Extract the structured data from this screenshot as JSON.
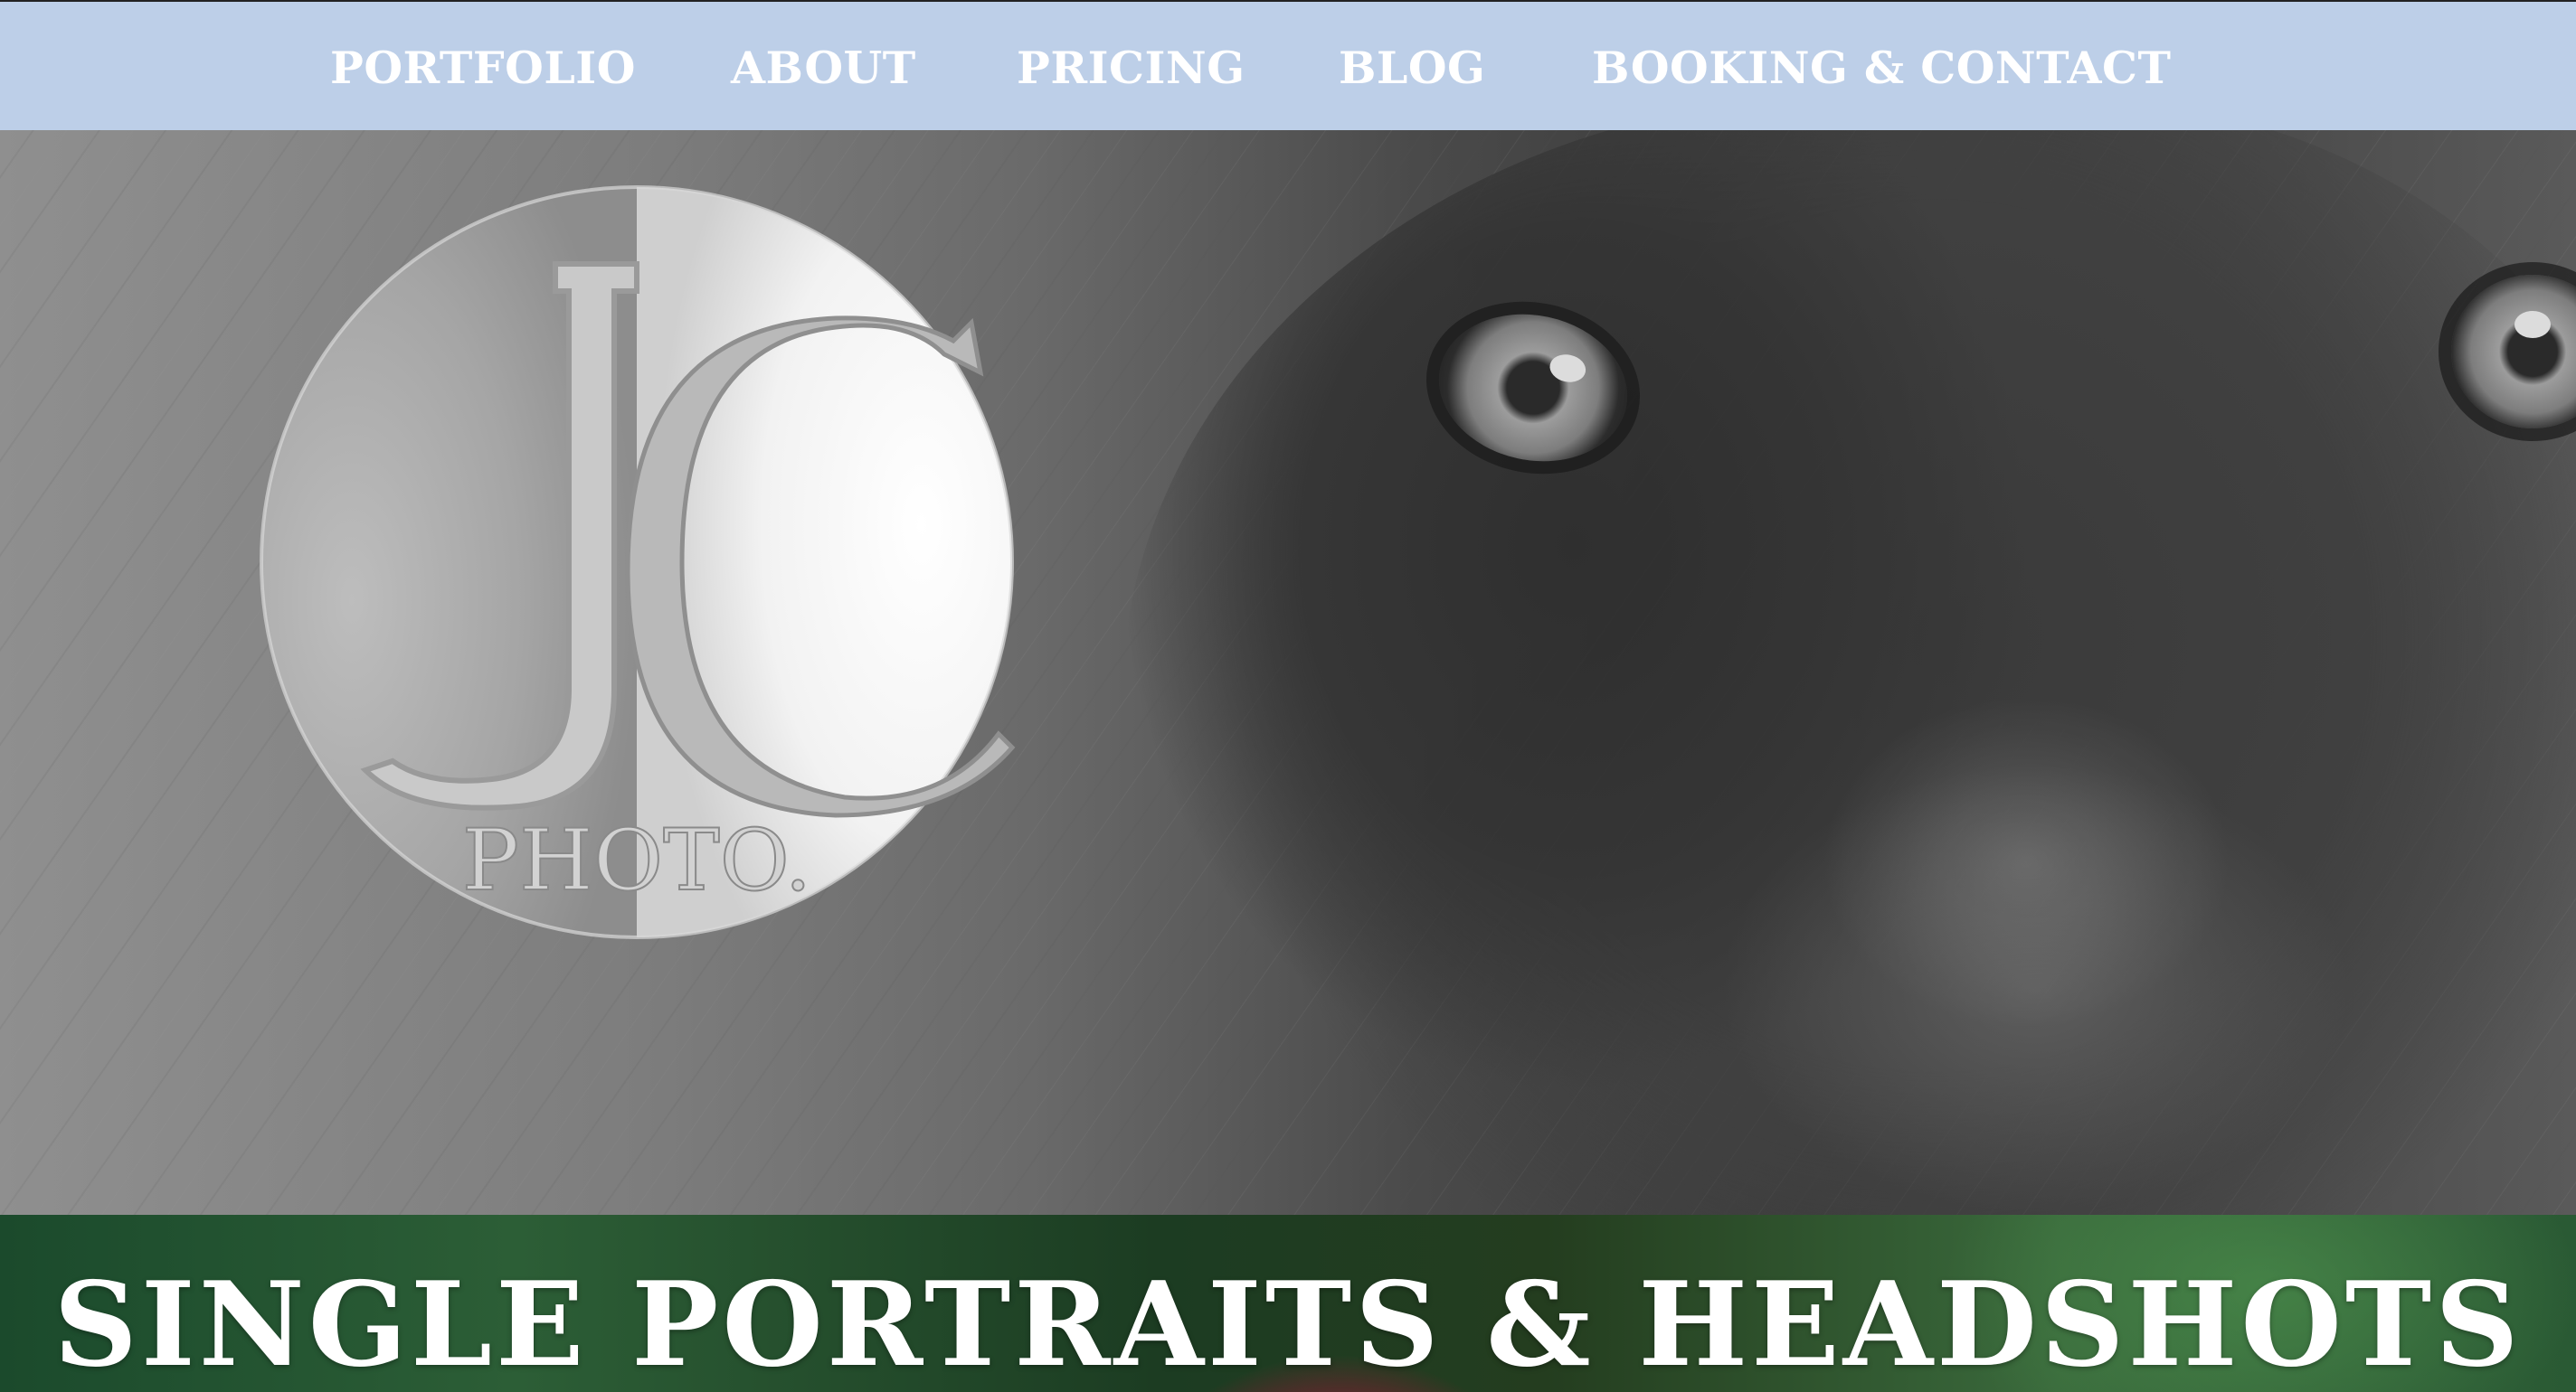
{
  "nav": {
    "items": [
      {
        "label": "PORTFOLIO"
      },
      {
        "label": "ABOUT"
      },
      {
        "label": "PRICING"
      },
      {
        "label": "BLOG"
      },
      {
        "label": "BOOKING  & CONTACT"
      }
    ]
  },
  "logo": {
    "letters": "JC",
    "subtitle": "PHOTO."
  },
  "banner": {
    "title": "SINGLE PORTRAITS &  HEADSHOTS"
  },
  "colors": {
    "nav_background": "#bdcfe8",
    "nav_text": "#ffffff",
    "banner_text": "#ffffff"
  }
}
